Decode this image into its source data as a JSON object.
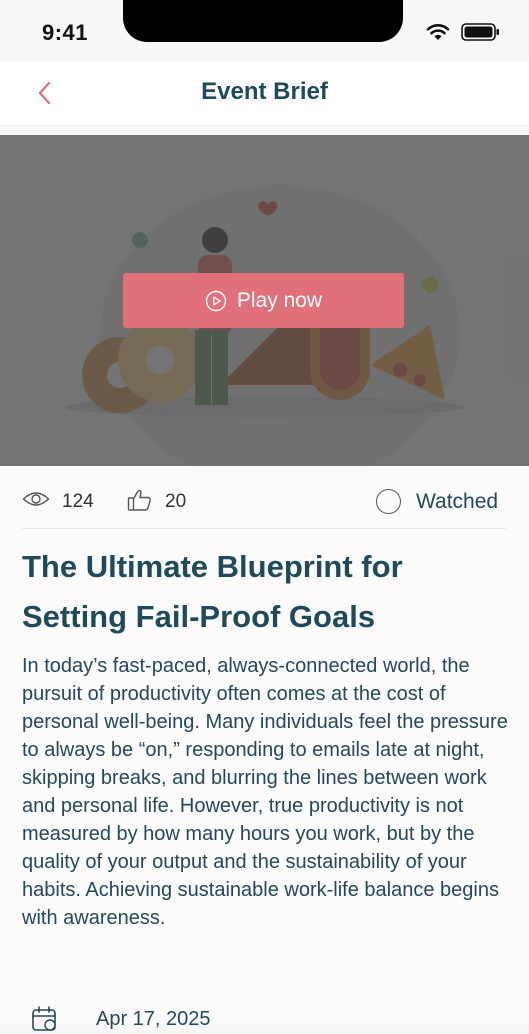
{
  "status_bar": {
    "time": "9:41"
  },
  "nav": {
    "title": "Event Brief"
  },
  "video": {
    "play_label": "Play now"
  },
  "stats": {
    "views": "124",
    "likes": "20",
    "watched_label": "Watched"
  },
  "article": {
    "title": "The Ultimate Blueprint for Setting Fail-Proof Goals",
    "body": "In today’s fast-paced, always-connected world, the pursuit of productivity often comes at the cost of personal well-being. Many individuals feel the pressure to always be “on,” responding to emails late at night, skipping breaks, and blurring the lines between work and personal life. However, true productivity is not measured by how many hours you work, but by the quality of your output and the sustainability of your habits. Achieving sustainable work-life balance begins with awareness."
  },
  "event": {
    "date": "Apr 17, 2025"
  },
  "colors": {
    "accent": "#e0707a",
    "title": "#1f4a5a",
    "overlay": "#464646"
  }
}
